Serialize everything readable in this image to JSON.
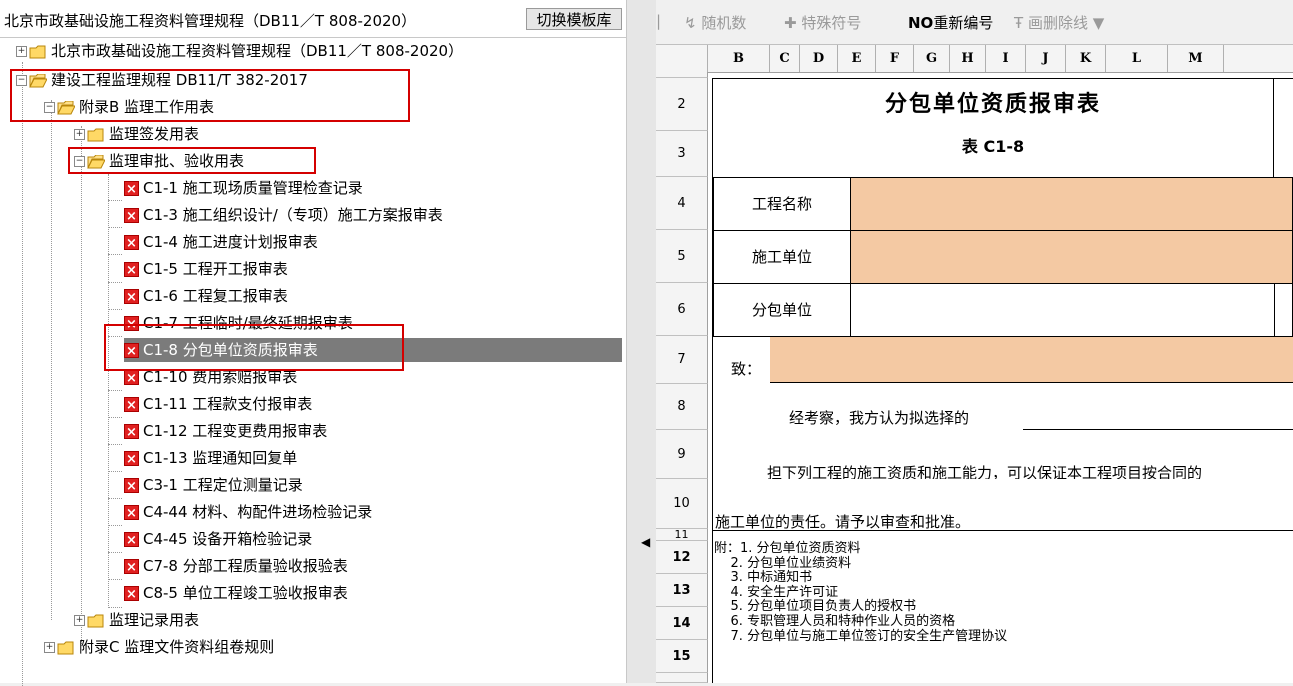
{
  "left": {
    "title": "北京市政基础设施工程资料管理规程（DB11／T 808-2020）",
    "switch_button": "切换模板库",
    "tree": [
      {
        "label": "北京市政基础设施工程资料管理规程（DB11／T 808-2020）",
        "type": "folder"
      },
      {
        "label": "建设工程监理规程 DB11/T 382-2017",
        "type": "folder"
      },
      {
        "label": "附录B 监理工作用表",
        "type": "folder"
      },
      {
        "label": "监理签发用表",
        "type": "folder"
      },
      {
        "label": "监理审批、验收用表",
        "type": "folder"
      },
      {
        "label": "C1-1 施工现场质量管理检查记录",
        "type": "form"
      },
      {
        "label": "C1-3 施工组织设计/（专项）施工方案报审表",
        "type": "form"
      },
      {
        "label": "C1-4 施工进度计划报审表",
        "type": "form"
      },
      {
        "label": "C1-5 工程开工报审表",
        "type": "form"
      },
      {
        "label": "C1-6 工程复工报审表",
        "type": "form"
      },
      {
        "label": "C1-7 工程临时/最终延期报审表",
        "type": "form"
      },
      {
        "label": "C1-8 分包单位资质报审表",
        "type": "form"
      },
      {
        "label": "C1-10 费用索赔报审表",
        "type": "form"
      },
      {
        "label": "C1-11 工程款支付报审表",
        "type": "form"
      },
      {
        "label": "C1-12 工程变更费用报审表",
        "type": "form"
      },
      {
        "label": "C1-13 监理通知回复单",
        "type": "form"
      },
      {
        "label": "C3-1 工程定位测量记录",
        "type": "form"
      },
      {
        "label": "C4-44 材料、构配件进场检验记录",
        "type": "form"
      },
      {
        "label": "C4-45 设备开箱检验记录",
        "type": "form"
      },
      {
        "label": "C7-8 分部工程质量验收报验表",
        "type": "form"
      },
      {
        "label": "C8-5 单位工程竣工验收报审表",
        "type": "form"
      },
      {
        "label": "监理记录用表",
        "type": "folder"
      },
      {
        "label": "附录C 监理文件资料组卷规则",
        "type": "folder"
      }
    ],
    "selected_item": "C1-8 分包单位资质报审表"
  },
  "toolbar": {
    "random": "随机数",
    "special_symbol": "特殊符号",
    "renumber_icon": "NO",
    "renumber": "重新编号",
    "strikethrough": "画删除线"
  },
  "sheet": {
    "columns": [
      "B",
      "C",
      "D",
      "E",
      "F",
      "G",
      "H",
      "I",
      "J",
      "K",
      "L",
      "M"
    ],
    "rows": [
      "2",
      "3",
      "4",
      "5",
      "6",
      "7",
      "8",
      "9",
      "10",
      "11",
      "12",
      "13",
      "14",
      "15"
    ],
    "form_title": "分包单位资质报审表",
    "form_code": "表 C1-8",
    "project_name_label": "工程名称",
    "construction_unit_label": "施工单位",
    "subcontract_unit_label": "分包单位",
    "to_label": "致：",
    "text_line1": "经考察，我方认为拟选择的",
    "text_line2": "担下列工程的施工资质和施工能力，可以保证本工程项目按合同的",
    "text_line3": "施工单位的责任。请予以审查和批准。",
    "notes": "附：1. 分包单位资质资料\n    2. 分包单位业绩资料\n    3. 中标通知书\n    4. 安全生产许可证\n    5. 分包单位项目负责人的授权书\n    6. 专职管理人员和特种作业人员的资格\n    7. 分包单位与施工单位签订的安全生产管理协议"
  },
  "colors": {
    "highlight_red": "#d40000",
    "peach_fill": "#f4c9a3",
    "selection_gray": "#7b7b7b"
  }
}
